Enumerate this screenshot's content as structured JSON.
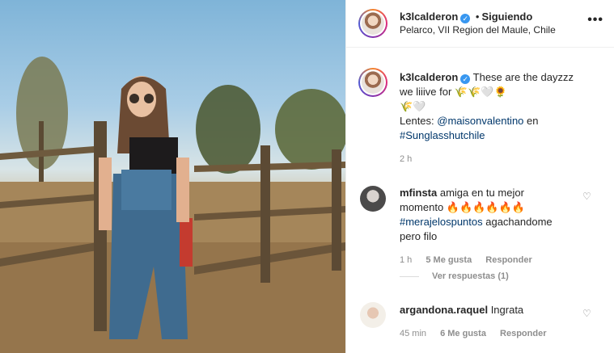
{
  "post": {
    "username": "k3lcalderon",
    "follow_status": "Siguiendo",
    "separator": "•",
    "location": "Pelarco, VII Region del Maule, Chile",
    "more": "•••",
    "verified_mark": "✓"
  },
  "caption": {
    "username": "k3lcalderon",
    "text_line1": "These are the dayzzz",
    "text_line2": "we liiive for 🌾🌾🤍🌻",
    "text_line3": "🌾🤍",
    "lentes_label": "Lentes: ",
    "mention": "@maisonvalentino",
    "mention_suffix": " en",
    "hashtag": "#Sunglasshutchile",
    "time": "2 h"
  },
  "comments": [
    {
      "username": "mfinsta",
      "text1": " amiga en tu mejor",
      "text2": "momento 🔥🔥🔥🔥🔥🔥",
      "hashtag": "#merajelospuntos",
      "text3": " agachandome",
      "text4": "pero filo",
      "time": "1 h",
      "likes": "5 Me gusta",
      "reply": "Responder",
      "view_replies": "Ver respuestas (1)"
    },
    {
      "username": "argandona.raquel",
      "text1": " Ingrata",
      "time": "45 min",
      "likes": "6 Me gusta",
      "reply": "Responder"
    }
  ],
  "icons": {
    "heart": "heart-icon",
    "more": "more-options-icon"
  },
  "colors": {
    "link": "#00376b",
    "verified": "#3897f0",
    "muted": "#8e8e8e"
  }
}
